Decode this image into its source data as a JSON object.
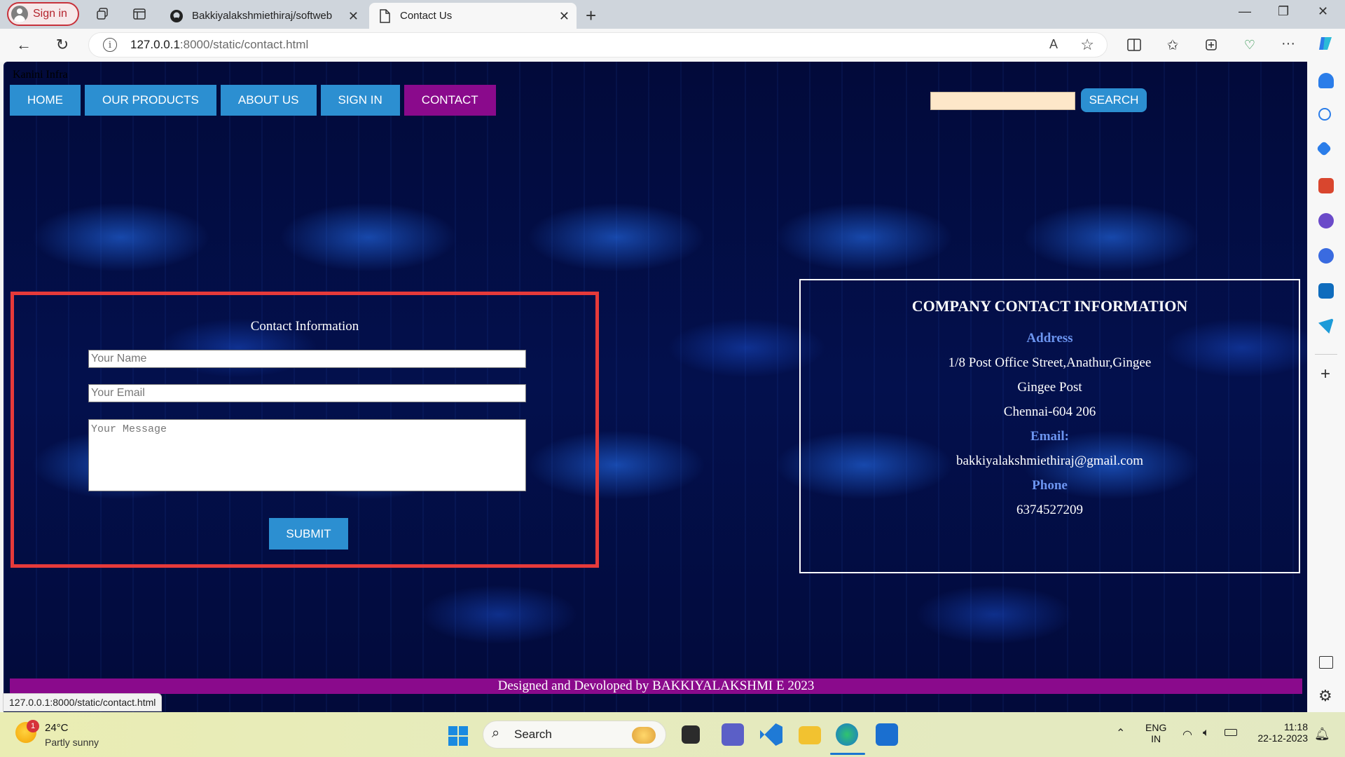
{
  "browser": {
    "signin_label": "Sign in",
    "tabs": [
      {
        "label": "Bakkiyalakshmiethiraj/softweb",
        "active": false
      },
      {
        "label": "Contact Us",
        "active": true
      }
    ],
    "url_host": "127.0.0.1",
    "url_rest": ":8000/static/contact.html",
    "status_url": "127.0.0.1:8000/static/contact.html"
  },
  "page": {
    "site_name": "Kanini Infra",
    "nav": [
      {
        "label": "HOME"
      },
      {
        "label": "OUR PRODUCTS"
      },
      {
        "label": "ABOUT US"
      },
      {
        "label": "SIGN IN"
      },
      {
        "label": "CONTACT"
      }
    ],
    "search_value": "",
    "search_label": "SEARCH",
    "form": {
      "title": "Contact Information",
      "name_placeholder": "Your Name",
      "email_placeholder": "Your Email",
      "message_placeholder": "Your Message",
      "submit_label": "SUBMIT"
    },
    "company": {
      "title": "COMPANY CONTACT INFORMATION",
      "address_heading": "Address",
      "address_line1": "1/8 Post Office Street,Anathur,Gingee",
      "address_line2": "Gingee Post",
      "address_line3": "Chennai-604 206",
      "email_heading": "Email:",
      "email": "bakkiyalakshmiethiraj@gmail.com",
      "phone_heading": "Phone",
      "phone": "6374527209"
    },
    "footer": "Designed and Devoloped by BAKKIYALAKSHMI E 2023"
  },
  "taskbar": {
    "weather_badge": "1",
    "temperature": "24°C",
    "weather": "Partly sunny",
    "search_label": "Search",
    "lang": "ENG",
    "region": "IN",
    "time": "11:18",
    "date": "22-12-2023"
  },
  "colors": {
    "nav_blue": "#2c8fd1",
    "nav_active": "#8a0a8c",
    "form_border": "#e63a3a",
    "heading_blue": "#6c95f0"
  }
}
